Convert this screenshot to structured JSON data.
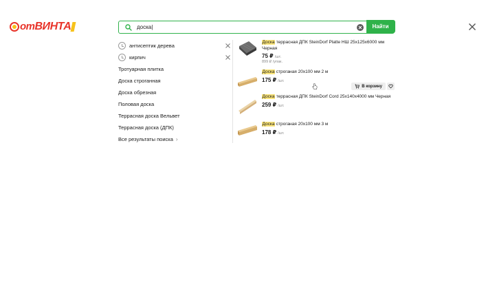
{
  "logo": {
    "prefix": "от",
    "name": "ВИНТА"
  },
  "search": {
    "value": "доска|",
    "placeholder": "",
    "button_label": "Найти"
  },
  "suggestions": {
    "history": [
      {
        "label": "антисептик дерева"
      },
      {
        "label": "кирпич"
      }
    ],
    "items": [
      {
        "label": "Тротуарная плитка"
      },
      {
        "label": "Доска строганная"
      },
      {
        "label": "Доска обрезная"
      },
      {
        "label": "Половая доска"
      },
      {
        "label": "Террасная доска Вельвет"
      },
      {
        "label": "Террасная доска (ДПК)"
      }
    ],
    "all_results_label": "Все результаты поиска"
  },
  "products": [
    {
      "highlight": "Доска",
      "title": " террасная ДПК SteinDorf Platte НШ 25x125x6000 мм Черная",
      "price": "75 ₽",
      "unit": "/шт.",
      "pack": "899 ₽ /упак."
    },
    {
      "highlight": "Доска",
      "title": " строганая 20x100 мм 2 м",
      "price": "175 ₽",
      "unit": "/шт.",
      "cart_label": "В корзину"
    },
    {
      "highlight": "Доска",
      "title": " террасная ДПК SteinDorf Cord 25x140x4000 мм Черная",
      "price": "259 ₽",
      "unit": "/шт."
    },
    {
      "highlight": "Доска",
      "title": " строганая 20x100 мм 3 м",
      "price": "178 ₽",
      "unit": "/шт."
    }
  ],
  "colors": {
    "accent": "#2fb24a",
    "brand_red": "#e8342a",
    "brand_yellow": "#f7c21b",
    "highlight": "#fbe57a"
  },
  "icons": [
    "search-icon",
    "clear-icon",
    "close-icon",
    "history-icon",
    "remove-icon",
    "chevron-right-icon",
    "cart-icon",
    "heart-icon",
    "hand-cursor-icon"
  ]
}
